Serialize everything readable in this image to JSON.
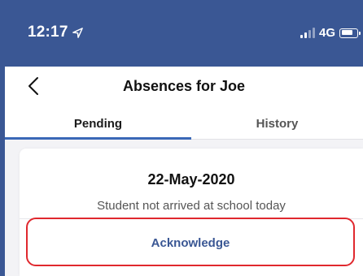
{
  "status_bar": {
    "time": "12:17",
    "location_icon": "location-arrow-icon",
    "network": "4G",
    "signal_icon": "cellular-signal-icon",
    "battery_icon": "battery-icon",
    "background_color": "#3a5794"
  },
  "nav": {
    "back_icon": "chevron-left-icon",
    "title": "Absences for Joe"
  },
  "tabs": [
    {
      "label": "Pending",
      "selected": true
    },
    {
      "label": "History",
      "selected": false
    }
  ],
  "absence": {
    "date": "22-May-2020",
    "message": "Student not arrived at school today",
    "action_label": "Acknowledge"
  },
  "colors": {
    "accent": "#3a5794",
    "tab_indicator": "#3a68b7",
    "highlight": "#e0282e"
  }
}
